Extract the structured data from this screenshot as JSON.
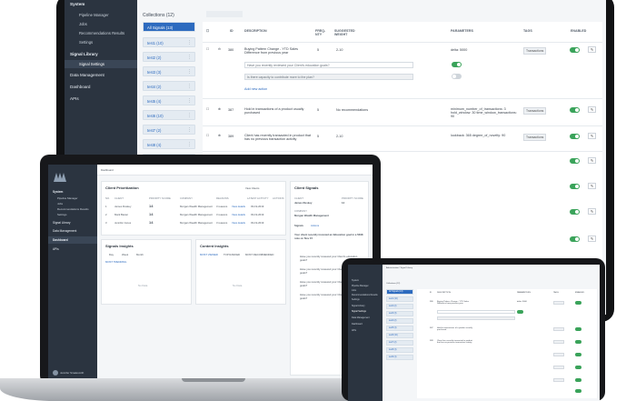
{
  "monitor": {
    "sidebar": {
      "system_label": "System",
      "system_items": [
        "Pipeline Manager",
        "Jobs",
        "Recommendations Results",
        "Settings"
      ],
      "signal_library_label": "Signal Library",
      "signal_items": [
        "Signal Settings"
      ],
      "data_management": "Data Management",
      "dashboard": "Dashboard",
      "apis": "APIs"
    },
    "collections_title": "Collections (12)",
    "collections": [
      {
        "label": "All Signals (13)",
        "active": true
      },
      {
        "label": "test1 (10)"
      },
      {
        "label": "test2 (2)"
      },
      {
        "label": "test3 (3)"
      },
      {
        "label": "test4 (2)"
      },
      {
        "label": "test5 (4)"
      },
      {
        "label": "test6 (10)"
      },
      {
        "label": "test7 (2)"
      },
      {
        "label": "test8 (4)"
      },
      {
        "label": "test9 (4)"
      }
    ],
    "table_headers": {
      "id": "ID",
      "description": "DESCRIPTION",
      "frequency": "FREQ-\nNTY",
      "suggested_weight": "SUGGESTED\nWEIGHT",
      "parameters": "PARAMETERS",
      "tags": "TAGS",
      "enabled": "ENABLED"
    },
    "rows": [
      {
        "id": "380",
        "description": "Buying Pattern Change - YTD Sales Difference from previous year",
        "freq": "5",
        "weight": "2-10",
        "params": "delta: 5000",
        "tag": "Transactions",
        "q1": "Have you recently reviewed your Client's education goals?",
        "q2": "Is there capacity to contribute more to the plan?",
        "add": "Add new action"
      },
      {
        "id": "387",
        "description": "Hold in transactions of a product usually purchased",
        "freq": "5",
        "weight": "No recommendations",
        "params": "minimum_number_of_transactions: 3 hold_window: 30 time_window_transactions: 90",
        "tag": "Transactions"
      },
      {
        "id": "389",
        "description": "Client has recently transacted in product that has no previous transaction activity",
        "freq": "5",
        "weight": "2-10",
        "params": "lookback: 365 degree_of_novelty: 90",
        "tag": "Transactions"
      }
    ]
  },
  "laptop": {
    "breadcrumb": "Dashboard",
    "client_prioritization": {
      "title": "Client Prioritization",
      "filter": "View Clients",
      "headers": [
        "NO.",
        "CLIENT",
        "PRIORITY SCORE",
        "COMPANY",
        "REASONS",
        "LATEST ACTIVITY",
        "ACTIONS"
      ],
      "rows": [
        {
          "no": "1",
          "client": "James Ruskey",
          "score": "14",
          "company": "Morgan Wealth Management",
          "reasons": "3 reasons",
          "action": "View details",
          "date": "03-19-2019"
        },
        {
          "no": "2",
          "client": "Mark Baxter",
          "score": "14",
          "company": "Morgan Wealth Management",
          "reasons": "3 reasons",
          "action": "View details",
          "date": "03-19-2019"
        },
        {
          "no": "3",
          "client": "Jennifer Jones",
          "score": "14",
          "company": "Morgan Wealth Management",
          "reasons": "3 reasons",
          "action": "View details",
          "date": "03-19-2019"
        }
      ]
    },
    "client_signals": {
      "title": "Client Signals",
      "client_label": "CLIENT",
      "client_name": "James Ruskey",
      "company_label": "COMPANY",
      "company_name": "Morgan Wealth Management",
      "priority_label": "PRIORITY SCORE",
      "priority_value": "14",
      "signals_tab": "Signals",
      "actions_tab": "Actions",
      "headline": "Your client recently invested an Education goal in a 529K note on Nov 15",
      "q1": "Have you recently reviewed your Client's education goals?",
      "q2": "Have you recently reviewed your Client's education goals?",
      "q3": "Have you recently reviewed your Client's education goals?",
      "q4": "Have you recently reviewed your Client's education goals?"
    },
    "signals_insights": {
      "title": "Signals Insights",
      "tabs": [
        "Day",
        "Week",
        "Month"
      ],
      "link": "MOST TRENDING",
      "empty": "No Data"
    },
    "content_insights": {
      "title": "Content Insights",
      "tabs": [
        "MOST VIEWED",
        "TOP RANKED",
        "MOST RECOMMENDED"
      ],
      "empty": "No Data"
    },
    "user": "Jennifer Smalesmith"
  },
  "tablet": {
    "breadcrumb": "Administration / Signal Library",
    "collections_title": "Collections (12)",
    "collections": [
      "All Signals (13)",
      "test1 (10)",
      "test2 (2)",
      "test3 (3)",
      "test4 (2)",
      "test5 (4)",
      "test6 (10)",
      "test7 (2)",
      "test8 (4)",
      "test9 (4)"
    ]
  }
}
